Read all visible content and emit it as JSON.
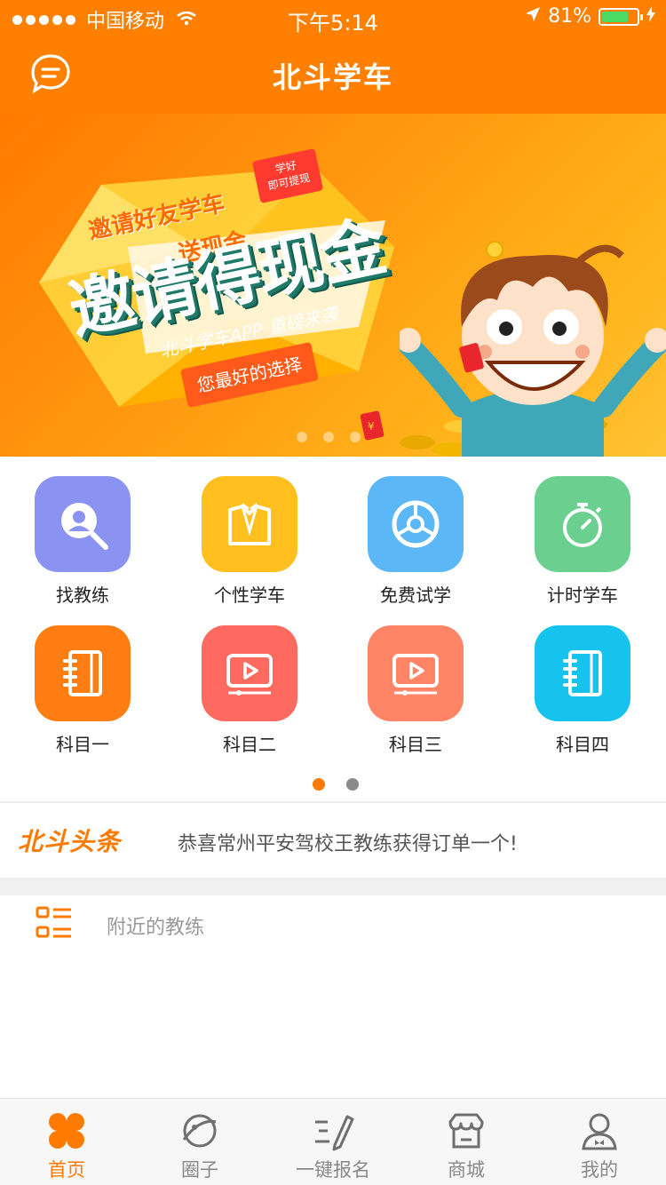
{
  "status_bar": {
    "carrier": "中国移动",
    "time": "下午5:14",
    "battery": "81%",
    "battery_level": 0.81
  },
  "header": {
    "title": "北斗学车"
  },
  "banner": {
    "small_line1": "邀请好友学车",
    "small_line2": "送现金",
    "big_text": "邀请得现金",
    "sub_text": "北斗学车APP 重磅来袭",
    "ribbon_text": "您最好的选择",
    "tag_line1": "学好",
    "tag_line2": "即可提现",
    "page_count": 3
  },
  "grid": {
    "items": [
      {
        "label": "找教练",
        "icon": "coach-search-icon",
        "color": "#8b93f2"
      },
      {
        "label": "个性学车",
        "icon": "suit-icon",
        "color": "#ffbf1f"
      },
      {
        "label": "免费试学",
        "icon": "steering-wheel-icon",
        "color": "#5cb7f7"
      },
      {
        "label": "计时学车",
        "icon": "stopwatch-icon",
        "color": "#6bd08f"
      },
      {
        "label": "科目一",
        "icon": "notebook-icon",
        "color": "#ff7d12"
      },
      {
        "label": "科目二",
        "icon": "video-icon",
        "color": "#ff6a60"
      },
      {
        "label": "科目三",
        "icon": "video-icon",
        "color": "#ff8566"
      },
      {
        "label": "科目四",
        "icon": "notebook-icon",
        "color": "#15c3ee"
      }
    ],
    "pager": {
      "active_color": "#ff7a00",
      "inactive_color": "#8a8a8a"
    }
  },
  "headline": {
    "logo": "北斗头条",
    "text": "恭喜常州平安驾校王教练获得订单一个!"
  },
  "nearby": {
    "label": "附近的教练"
  },
  "tabbar": {
    "items": [
      {
        "label": "首页",
        "icon": "home-clover-icon",
        "active": true
      },
      {
        "label": "圈子",
        "icon": "planet-icon",
        "active": false
      },
      {
        "label": "一键报名",
        "icon": "sign-up-pen-icon",
        "active": false
      },
      {
        "label": "商城",
        "icon": "shop-icon",
        "active": false
      },
      {
        "label": "我的",
        "icon": "user-icon",
        "active": false
      }
    ]
  },
  "colors": {
    "brand": "#ff8000",
    "accent": "#ff7a00"
  }
}
